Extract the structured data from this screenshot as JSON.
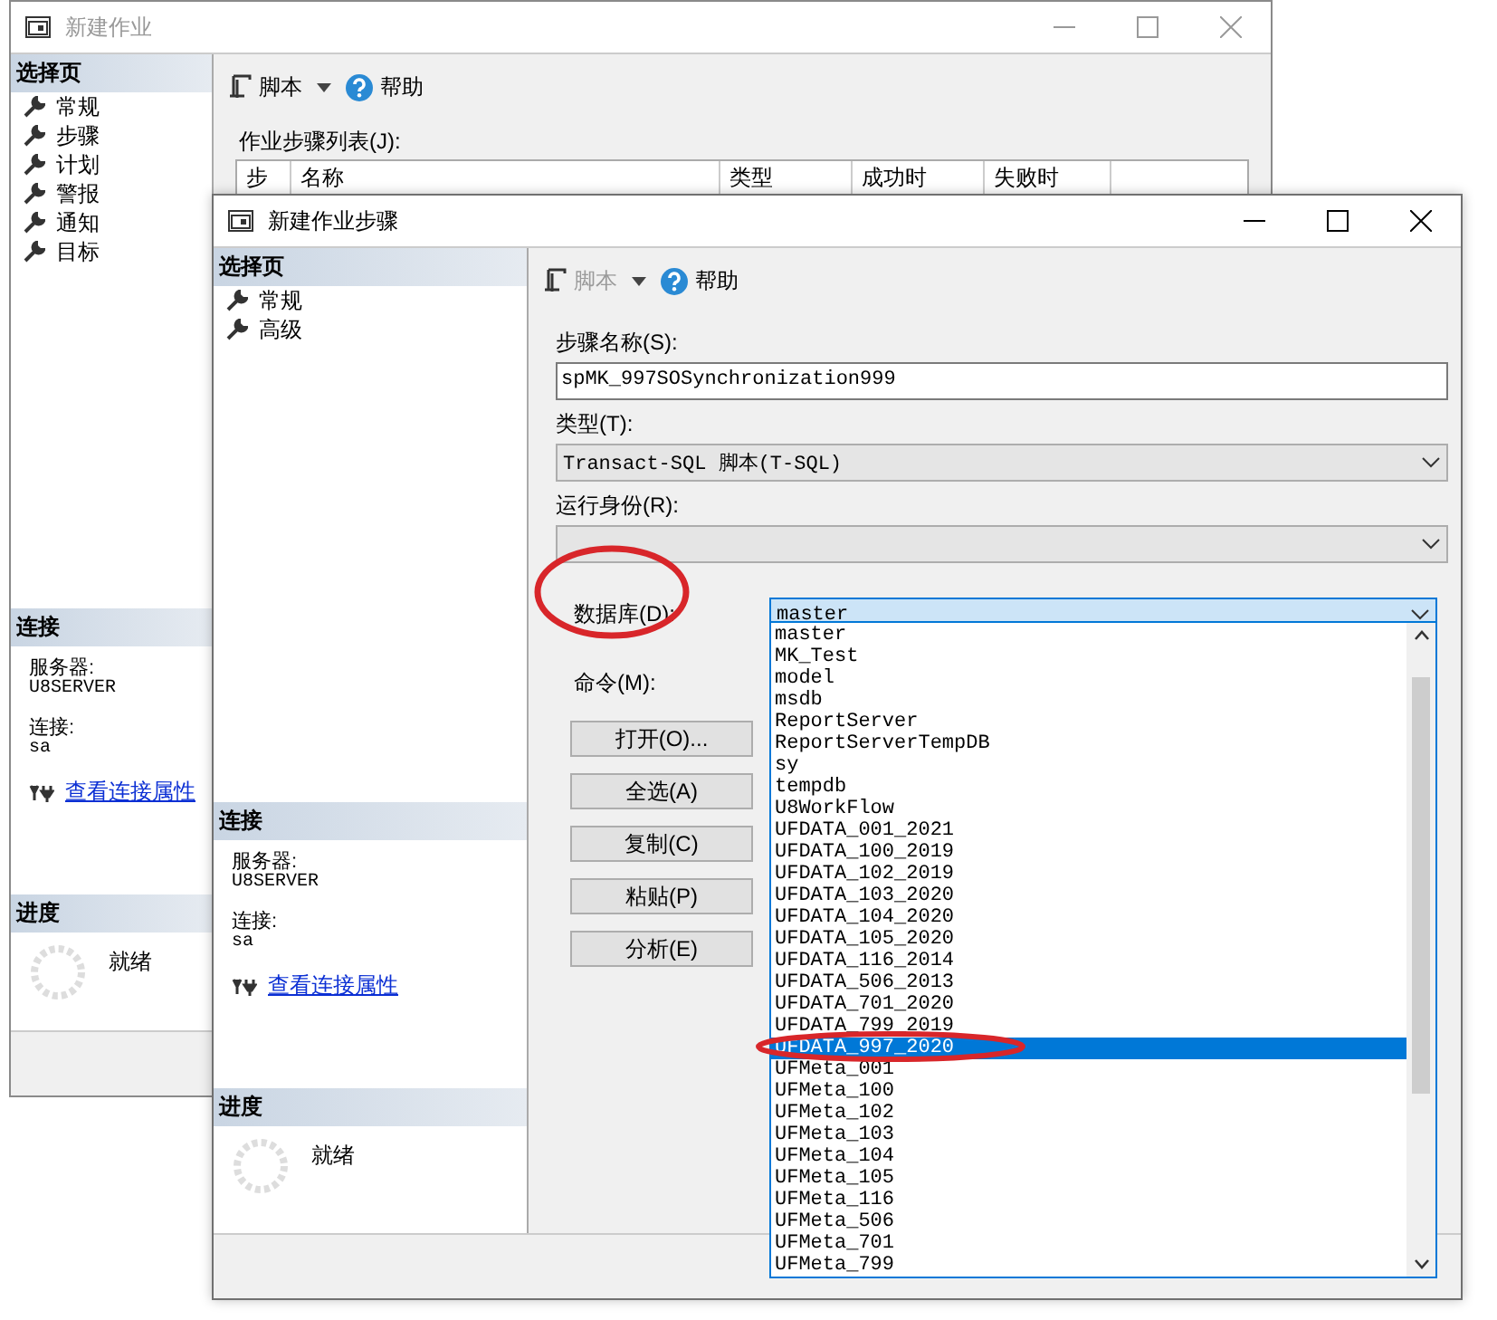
{
  "windows": [
    {
      "kind": "job",
      "title": "新建作业",
      "active": false,
      "sidebar": {
        "header": "选择页",
        "items": [
          "常规",
          "步骤",
          "计划",
          "警报",
          "通知",
          "目标"
        ],
        "connection": {
          "header": "连接",
          "server_label": "服务器:",
          "server": "U8SERVER",
          "login_label": "连接:",
          "login": "sa",
          "link": "查看连接属性"
        },
        "progress": {
          "header": "进度",
          "status": "就绪"
        }
      },
      "toolbar": {
        "script": "脚本",
        "script_disabled": false,
        "help": "帮助"
      },
      "steps_label": "作业步骤列表(J):",
      "columns": [
        "步",
        "名称",
        "类型",
        "成功时",
        "失败时"
      ]
    },
    {
      "kind": "step",
      "title": "新建作业步骤",
      "active": true,
      "sidebar": {
        "header": "选择页",
        "items": [
          "常规",
          "高级"
        ],
        "connection": {
          "header": "连接",
          "server_label": "服务器:",
          "server": "U8SERVER",
          "login_label": "连接:",
          "login": "sa",
          "link": "查看连接属性"
        },
        "progress": {
          "header": "进度",
          "status": "就绪"
        }
      },
      "toolbar": {
        "script": "脚本",
        "script_disabled": true,
        "help": "帮助"
      },
      "fields": [
        {
          "kind": "text",
          "label": "步骤名称(S):",
          "value": "spMK_997SOSynchronization999"
        },
        {
          "kind": "select",
          "label": "类型(T):",
          "value": "Transact-SQL 脚本(T-SQL)"
        },
        {
          "kind": "select",
          "label": "运行身份(R):"
        }
      ],
      "database": {
        "label": "数据库(D):",
        "value": "master"
      },
      "command_label": "命令(M):",
      "buttons": [
        "打开(O)...",
        "全选(A)",
        "复制(C)",
        "粘贴(P)",
        "分析(E)"
      ],
      "dropdown": [
        {
          "label": "master",
          "selected": false
        },
        {
          "label": "MK_Test",
          "selected": false
        },
        {
          "label": "model",
          "selected": false
        },
        {
          "label": "msdb",
          "selected": false
        },
        {
          "label": "ReportServer",
          "selected": false
        },
        {
          "label": "ReportServerTempDB",
          "selected": false
        },
        {
          "label": "sy",
          "selected": false
        },
        {
          "label": "tempdb",
          "selected": false
        },
        {
          "label": "U8WorkFlow",
          "selected": false
        },
        {
          "label": "UFDATA_001_2021",
          "selected": false
        },
        {
          "label": "UFDATA_100_2019",
          "selected": false
        },
        {
          "label": "UFDATA_102_2019",
          "selected": false
        },
        {
          "label": "UFDATA_103_2020",
          "selected": false
        },
        {
          "label": "UFDATA_104_2020",
          "selected": false
        },
        {
          "label": "UFDATA_105_2020",
          "selected": false
        },
        {
          "label": "UFDATA_116_2014",
          "selected": false
        },
        {
          "label": "UFDATA_506_2013",
          "selected": false
        },
        {
          "label": "UFDATA_701_2020",
          "selected": false
        },
        {
          "label": "UFDATA_799_2019",
          "selected": false
        },
        {
          "label": "UFDATA_997_2020",
          "selected": true
        },
        {
          "label": "UFMeta_001",
          "selected": false
        },
        {
          "label": "UFMeta_100",
          "selected": false
        },
        {
          "label": "UFMeta_102",
          "selected": false
        },
        {
          "label": "UFMeta_103",
          "selected": false
        },
        {
          "label": "UFMeta_104",
          "selected": false
        },
        {
          "label": "UFMeta_105",
          "selected": false
        },
        {
          "label": "UFMeta_116",
          "selected": false
        },
        {
          "label": "UFMeta_506",
          "selected": false
        },
        {
          "label": "UFMeta_701",
          "selected": false
        },
        {
          "label": "UFMeta_799",
          "selected": false
        }
      ]
    }
  ]
}
